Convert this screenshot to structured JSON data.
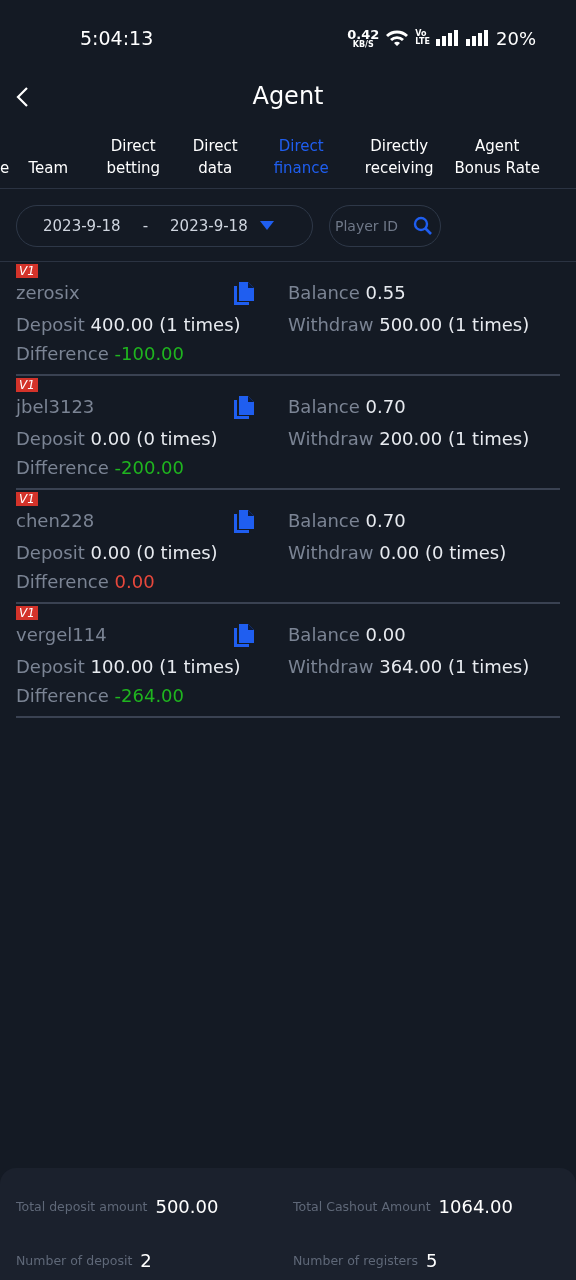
{
  "status_bar": {
    "time": "5:04:13",
    "speed": "0.42",
    "speed_unit": "KB/S",
    "volte_top": "Vo",
    "volte_bottom": "LTE",
    "battery": "20%"
  },
  "header": {
    "title": "Agent"
  },
  "tabs": [
    {
      "label": "e",
      "selected": false
    },
    {
      "label": "Team",
      "selected": false
    },
    {
      "label": "Direct betting",
      "selected": false
    },
    {
      "label": "Direct data",
      "selected": false
    },
    {
      "label": "Direct finance",
      "selected": true
    },
    {
      "label": "Directly receiving",
      "selected": false
    },
    {
      "label": "Agent Bonus Rate",
      "selected": false
    }
  ],
  "filter": {
    "start_date": "2023-9-18",
    "separator": "-",
    "end_date": "2023-9-18",
    "search_placeholder": "Player ID"
  },
  "records": [
    {
      "level_badge": "V1",
      "username": "zerosix",
      "balance_label": "Balance",
      "balance": "0.55",
      "deposit_label": "Deposit",
      "deposit": "400.00",
      "deposit_times": "(1 times)",
      "withdraw_label": "Withdraw",
      "withdraw": "500.00",
      "withdraw_times": "(1 times)",
      "difference_label": "Difference",
      "difference": "-100.00",
      "kind": "negative"
    },
    {
      "level_badge": "V1",
      "username": "jbel3123",
      "balance_label": "Balance",
      "balance": "0.70",
      "deposit_label": "Deposit",
      "deposit": "0.00",
      "deposit_times": "(0 times)",
      "withdraw_label": "Withdraw",
      "withdraw": "200.00",
      "withdraw_times": "(1 times)",
      "difference_label": "Difference",
      "difference": "-200.00",
      "kind": "negative"
    },
    {
      "level_badge": "V1",
      "username": "chen228",
      "balance_label": "Balance",
      "balance": "0.70",
      "deposit_label": "Deposit",
      "deposit": "0.00",
      "deposit_times": "(0 times)",
      "withdraw_label": "Withdraw",
      "withdraw": "0.00",
      "withdraw_times": "(0 times)",
      "difference_label": "Difference",
      "difference": "0.00",
      "kind": "zero"
    },
    {
      "level_badge": "V1",
      "username": "vergel114",
      "balance_label": "Balance",
      "balance": "0.00",
      "deposit_label": "Deposit",
      "deposit": "100.00",
      "deposit_times": "(1 times)",
      "withdraw_label": "Withdraw",
      "withdraw": "364.00",
      "withdraw_times": "(1 times)",
      "difference_label": "Difference",
      "difference": "-264.00",
      "kind": "negative"
    }
  ],
  "summary": [
    {
      "label": "Total deposit amount",
      "value": "500.00"
    },
    {
      "label": "Total Cashout Amount",
      "value": "1064.00"
    },
    {
      "label": "Number of deposit",
      "value": "2"
    },
    {
      "label": "Number of registers",
      "value": "5"
    }
  ]
}
